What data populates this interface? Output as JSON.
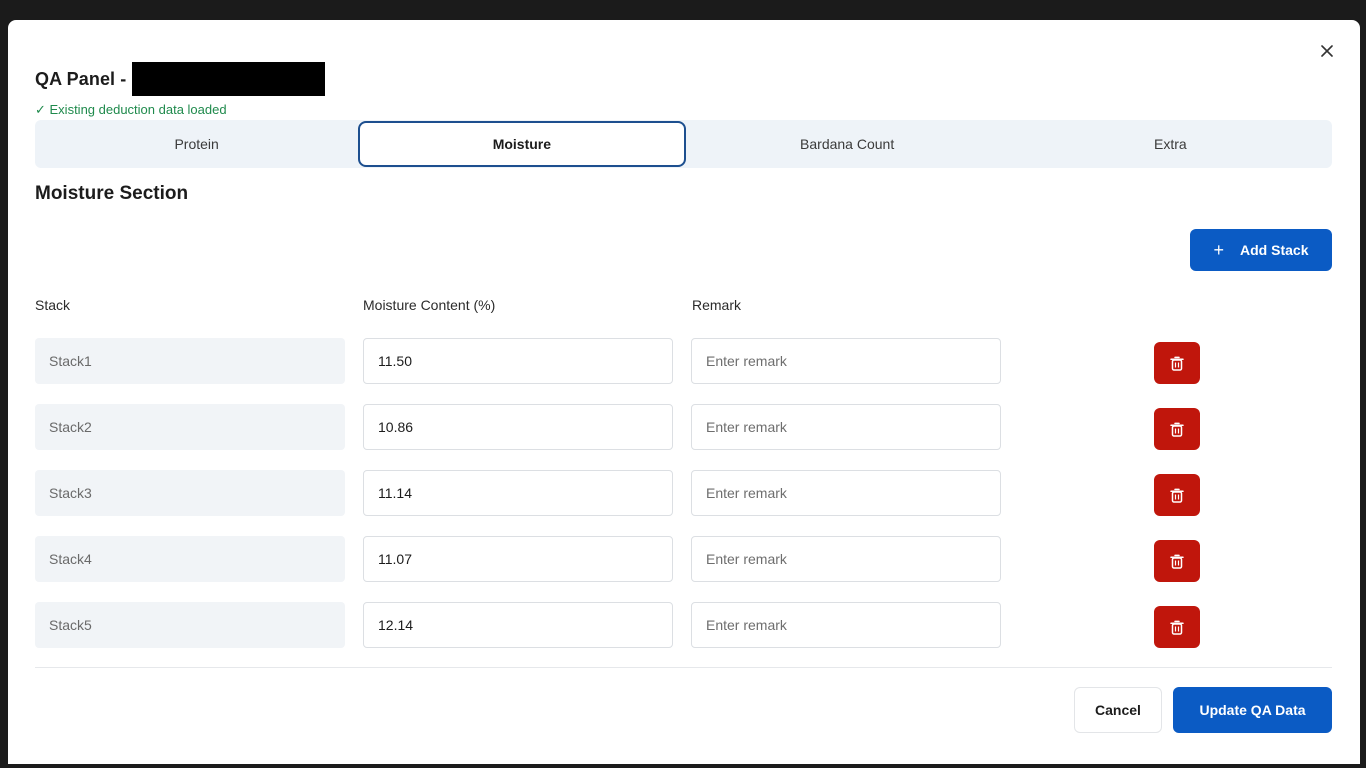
{
  "header": {
    "title": "QA Panel -",
    "status": "✓ Existing deduction data loaded",
    "close_icon": "close-icon"
  },
  "tabs": [
    {
      "label": "Protein",
      "active": false
    },
    {
      "label": "Moisture",
      "active": true
    },
    {
      "label": "Bardana Count",
      "active": false
    },
    {
      "label": "Extra",
      "active": false
    }
  ],
  "section": {
    "title": "Moisture Section",
    "add_label": "Add Stack",
    "add_icon": "plus-icon"
  },
  "columns": {
    "stack": "Stack",
    "moisture": "Moisture Content (%)",
    "remark": "Remark"
  },
  "rows": [
    {
      "stack": "Stack1",
      "moisture": "11.50",
      "remark": "",
      "remark_placeholder": "Enter remark"
    },
    {
      "stack": "Stack2",
      "moisture": "10.86",
      "remark": "",
      "remark_placeholder": "Enter remark"
    },
    {
      "stack": "Stack3",
      "moisture": "11.14",
      "remark": "",
      "remark_placeholder": "Enter remark"
    },
    {
      "stack": "Stack4",
      "moisture": "11.07",
      "remark": "",
      "remark_placeholder": "Enter remark"
    },
    {
      "stack": "Stack5",
      "moisture": "12.14",
      "remark": "",
      "remark_placeholder": "Enter remark"
    }
  ],
  "footer": {
    "cancel_label": "Cancel",
    "update_label": "Update QA Data"
  },
  "colors": {
    "primary": "#0b5bc4",
    "danger": "#c0160c",
    "success": "#1f8a4c",
    "active_tab_border": "#1d4f8f"
  }
}
